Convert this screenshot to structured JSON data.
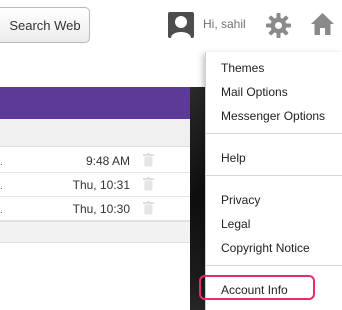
{
  "toolbar": {
    "search_button_label": "Search Web",
    "greeting": "Hi, sahil"
  },
  "messages": [
    {
      "time": "9:48 AM"
    },
    {
      "time": "Thu, 10:31"
    },
    {
      "time": "Thu, 10:30"
    }
  ],
  "menu": {
    "items": [
      "Themes",
      "Mail Options",
      "Messenger Options",
      "Help",
      "Privacy",
      "Legal",
      "Copyright Notice",
      "Account Info"
    ]
  },
  "colors": {
    "banner": "#5c3a95",
    "highlight": "#e0306a"
  },
  "icons": [
    "user-avatar-icon",
    "gear-icon",
    "home-icon",
    "trash-icon"
  ]
}
